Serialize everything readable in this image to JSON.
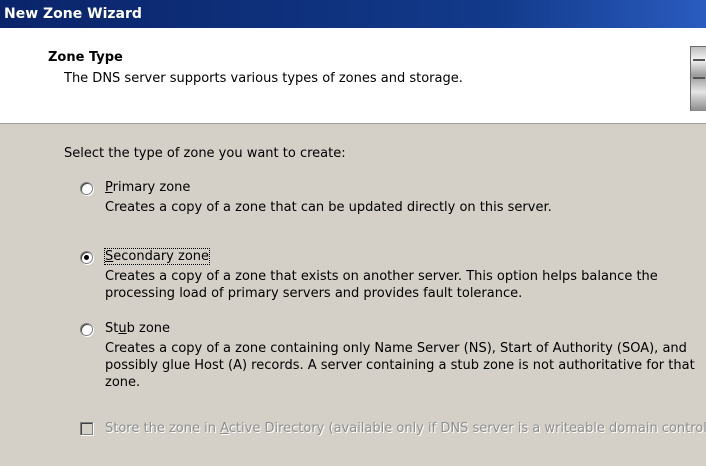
{
  "window": {
    "title": "New Zone Wizard"
  },
  "header": {
    "title": "Zone Type",
    "subtitle": "The DNS server supports various types of zones and storage."
  },
  "prompt": "Select the type of zone you want to create:",
  "options": [
    {
      "label_pre": "",
      "label_key": "P",
      "label_post": "rimary zone",
      "description": "Creates a copy of a zone that can be updated directly on this server.",
      "checked": false
    },
    {
      "label_pre": "",
      "label_key": "S",
      "label_post": "econdary zone",
      "description": "Creates a copy of a zone that exists on another server. This option helps balance the processing load of primary servers and provides fault tolerance.",
      "checked": true
    },
    {
      "label_pre": "St",
      "label_key": "u",
      "label_post": "b zone",
      "description": "Creates a copy of a zone containing only Name Server (NS), Start of Authority (SOA), and possibly glue Host (A) records. A server containing a stub zone is not authoritative for that zone.",
      "checked": false
    }
  ],
  "store_ad": {
    "label_pre": "Store the zone in ",
    "label_key": "A",
    "label_post": "ctive Directory (available only if DNS server is a writeable domain controller)",
    "checked": false,
    "disabled": true
  }
}
